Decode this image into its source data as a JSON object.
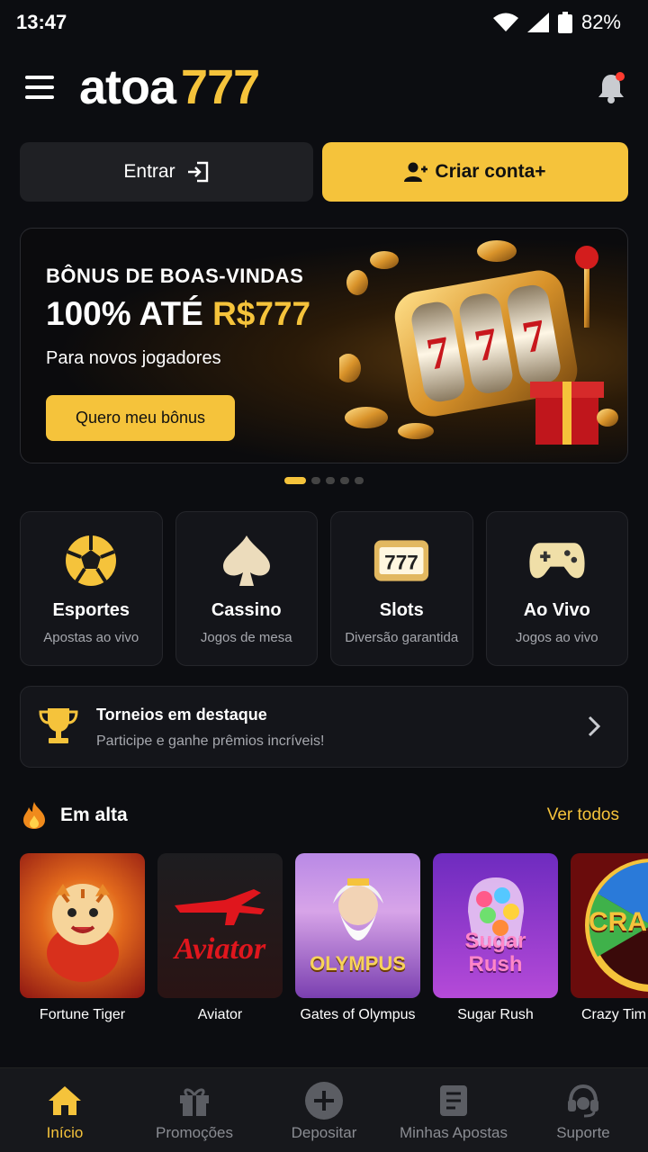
{
  "status_bar": {
    "time": "13:47",
    "battery": "82%"
  },
  "header": {
    "logo_left": "atoa",
    "logo_right": "777",
    "has_notification": true
  },
  "auth": {
    "login_label": "Entrar",
    "signup_label": "Criar conta+"
  },
  "banner": {
    "line1": "BÔNUS DE BOAS-VINDAS",
    "line2_prefix": "100% ATÉ ",
    "line2_highlight": "R$777",
    "line3": "Para novos jogadores",
    "cta": "Quero meu bônus",
    "slide_count": 5,
    "active_slide": 0
  },
  "categories": [
    {
      "name": "Esportes",
      "sub": "Apostas ao vivo",
      "icon": "soccer-ball-icon"
    },
    {
      "name": "Cassino",
      "sub": "Jogos de mesa",
      "icon": "spade-icon"
    },
    {
      "name": "Slots",
      "sub": "Diversão garantida",
      "icon": "slot-777-icon"
    },
    {
      "name": "Ao Vivo",
      "sub": "Jogos ao vivo",
      "icon": "gamepad-icon"
    }
  ],
  "tournaments": {
    "title": "Torneios em destaque",
    "subtitle": "Participe e ganhe prêmios incríveis!"
  },
  "trending": {
    "title": "Em alta",
    "see_all": "Ver todos",
    "games": [
      {
        "name": "Fortune Tiger",
        "art_text": ""
      },
      {
        "name": "Aviator",
        "art_text": "Aviator"
      },
      {
        "name": "Gates of Olympus",
        "art_text": "OLYMPUS"
      },
      {
        "name": "Sugar Rush",
        "art_text": "Sugar Rush"
      },
      {
        "name": "Crazy Tim",
        "art_text": "CRAZ"
      }
    ]
  },
  "nav": [
    {
      "label": "Início",
      "icon": "home-icon",
      "active": true
    },
    {
      "label": "Promoções",
      "icon": "gift-icon",
      "active": false
    },
    {
      "label": "Depositar",
      "icon": "plus-circle-icon",
      "active": false
    },
    {
      "label": "Minhas Apostas",
      "icon": "receipt-icon",
      "active": false
    },
    {
      "label": "Suporte",
      "icon": "headset-icon",
      "active": false
    }
  ],
  "colors": {
    "accent": "#f5c33b",
    "background": "#0c0d11",
    "card": "#14151a"
  }
}
